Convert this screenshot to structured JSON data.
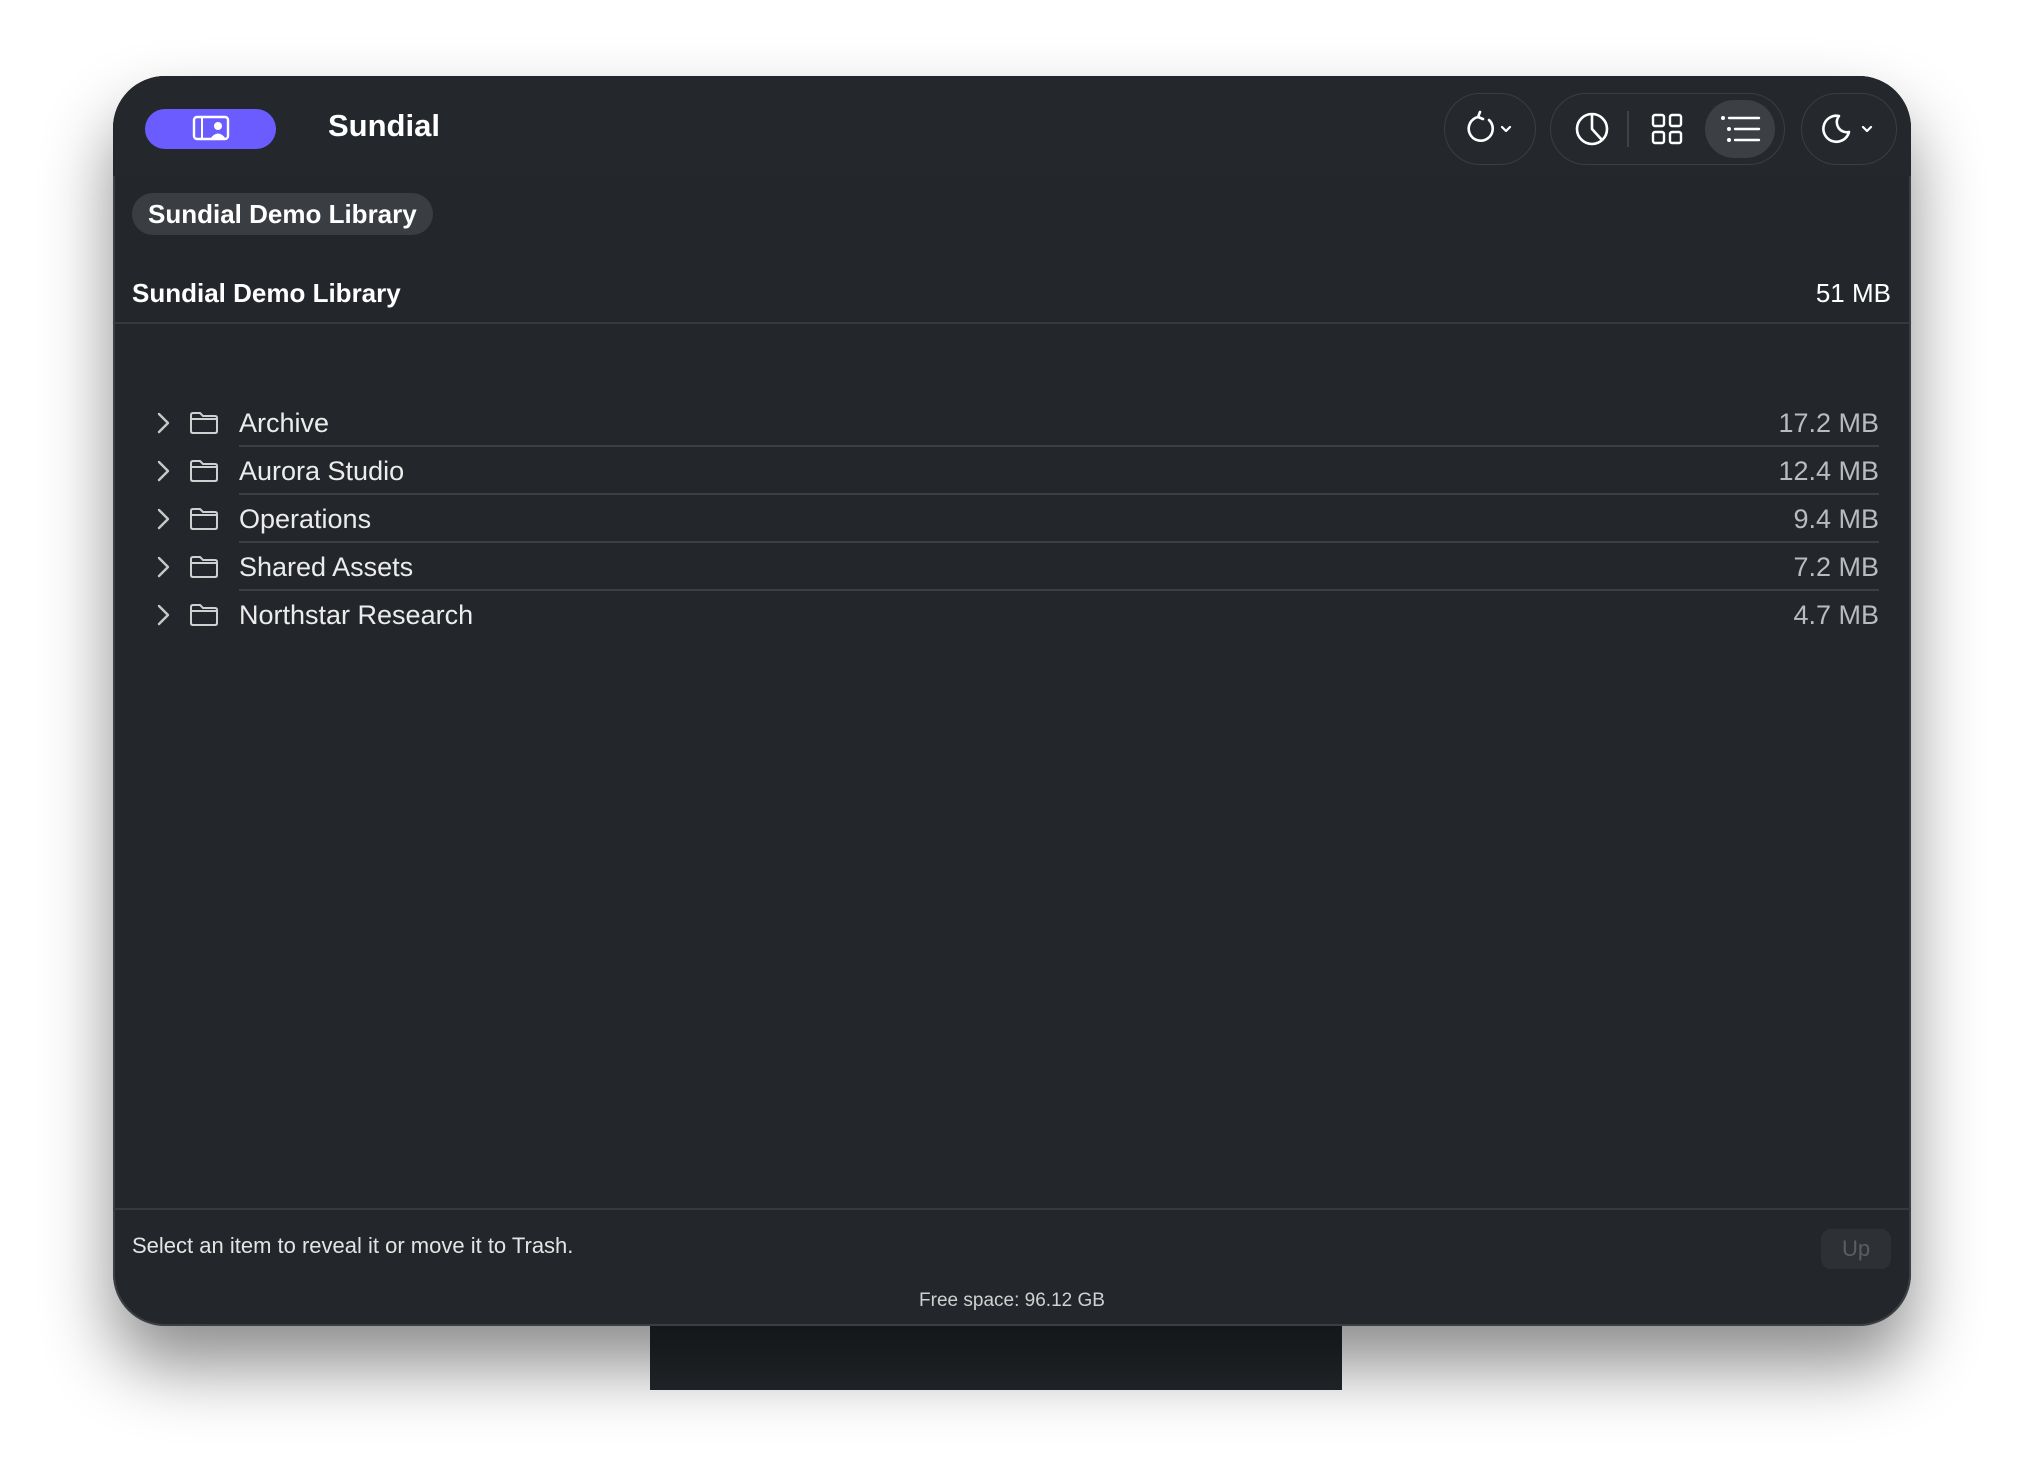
{
  "app": {
    "title": "Sundial"
  },
  "toolbar": {
    "refresh_icon": "refresh-icon",
    "chart_view_icon": "pie-chart-icon",
    "grid_view_icon": "grid-icon",
    "list_view_icon": "list-icon",
    "appearance_icon": "moon-icon",
    "active_view": "list"
  },
  "breadcrumb": {
    "label": "Sundial Demo Library"
  },
  "library": {
    "name": "Sundial Demo Library",
    "size": "51 MB"
  },
  "items": [
    {
      "name": "Archive",
      "size": "17.2 MB"
    },
    {
      "name": "Aurora Studio",
      "size": "12.4 MB"
    },
    {
      "name": "Operations",
      "size": "9.4 MB"
    },
    {
      "name": "Shared Assets",
      "size": "7.2 MB"
    },
    {
      "name": "Northstar Research",
      "size": "4.7 MB"
    }
  ],
  "footer": {
    "hint": "Select an item to reveal it or move it to Trash.",
    "up_label": "Up",
    "free_space": "Free space: 96.12 GB"
  },
  "colors": {
    "accent": "#6b5cff",
    "window_bg": "#23272b"
  }
}
